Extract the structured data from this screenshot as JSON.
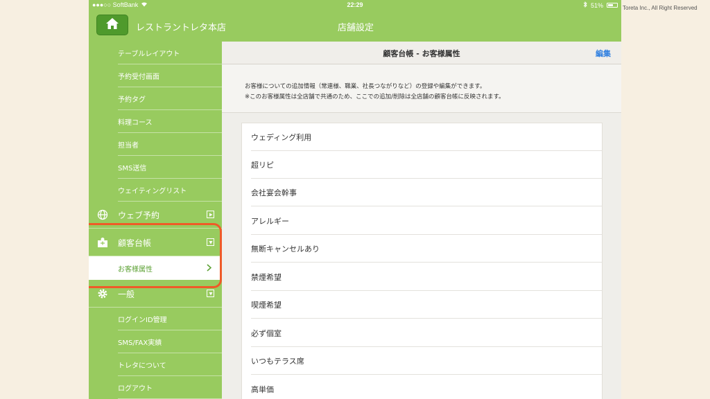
{
  "copyright": "Toreta Inc., All Right Reserved",
  "status_bar": {
    "carrier": "●●●○○ SoftBank",
    "time": "22:29",
    "battery": "51%"
  },
  "nav": {
    "store_name": "レストラントレタ本店",
    "title": "店舗設定"
  },
  "sidebar": {
    "top_items": [
      "テーブルレイアウト",
      "予約受付画面",
      "予約タグ",
      "料理コース",
      "担当者",
      "SMS送信",
      "ウェイティングリスト"
    ],
    "web_reservation": "ウェブ予約",
    "customer_ledger": "顧客台帳",
    "customer_attributes": "お客様属性",
    "general": "一般",
    "general_items": [
      "ログインID管理",
      "SMS/FAX実績",
      "トレタについて",
      "ログアウト"
    ]
  },
  "main": {
    "title": "顧客台帳 - お客様属性",
    "edit": "編集",
    "desc_line1": "お客様についての追加情報（常連様、職業、社長つながりなど）の登録や編集ができます。",
    "desc_line2": "※このお客様属性は全店舗で共通のため、ここでの追加/削除は全店舗の顧客台帳に反映されます。",
    "attributes": [
      "ウェディング利用",
      "超リピ",
      "会社宴会幹事",
      "アレルギー",
      "無断キャンセルあり",
      "禁煙希望",
      "喫煙希望",
      "必ず個室",
      "いつもテラス席",
      "高単価"
    ]
  },
  "colors": {
    "green": "#98cb5f",
    "dark_green": "#4f9a2c",
    "highlight": "#ef5a28",
    "link": "#2f7fe0"
  }
}
